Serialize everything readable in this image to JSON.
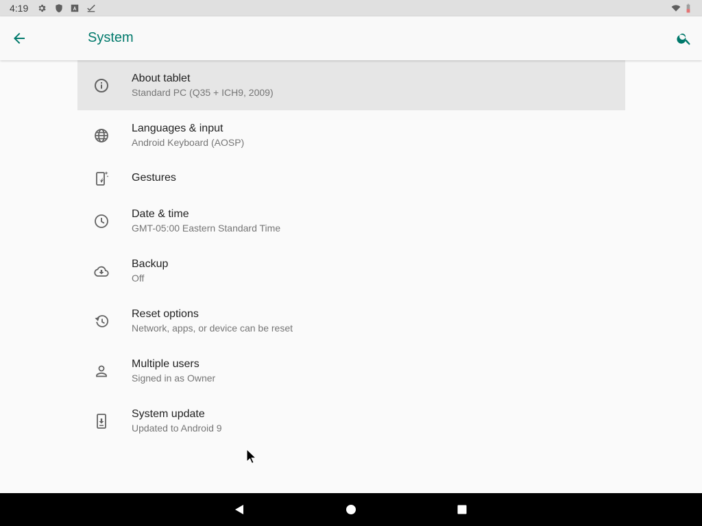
{
  "status_bar": {
    "time": "4:19",
    "left_icons": [
      "gear-icon",
      "shield-icon",
      "a-box-icon",
      "check-icon"
    ],
    "right_icons": [
      "wifi-icon",
      "battery-icon"
    ]
  },
  "app_bar": {
    "title": "System",
    "back_icon": "arrow-back-icon",
    "search_icon": "search-icon",
    "accent_color": "#00796b"
  },
  "items": [
    {
      "title": "About tablet",
      "summary": "Standard PC (Q35 + ICH9, 2009)",
      "icon": "info-icon",
      "highlighted": true
    },
    {
      "title": "Languages & input",
      "summary": "Android Keyboard (AOSP)",
      "icon": "globe-icon"
    },
    {
      "title": "Gestures",
      "summary": "",
      "icon": "gesture-phone-icon"
    },
    {
      "title": "Date & time",
      "summary": "GMT-05:00 Eastern Standard Time",
      "icon": "clock-icon"
    },
    {
      "title": "Backup",
      "summary": "Off",
      "icon": "cloud-upload-icon"
    },
    {
      "title": "Reset options",
      "summary": "Network, apps, or device can be reset",
      "icon": "history-icon"
    },
    {
      "title": "Multiple users",
      "summary": "Signed in as Owner",
      "icon": "person-icon"
    },
    {
      "title": "System update",
      "summary": "Updated to Android 9",
      "icon": "system-update-icon"
    }
  ],
  "nav_bar": {
    "buttons": [
      "back-triangle-icon",
      "home-circle-icon",
      "recents-square-icon"
    ]
  }
}
